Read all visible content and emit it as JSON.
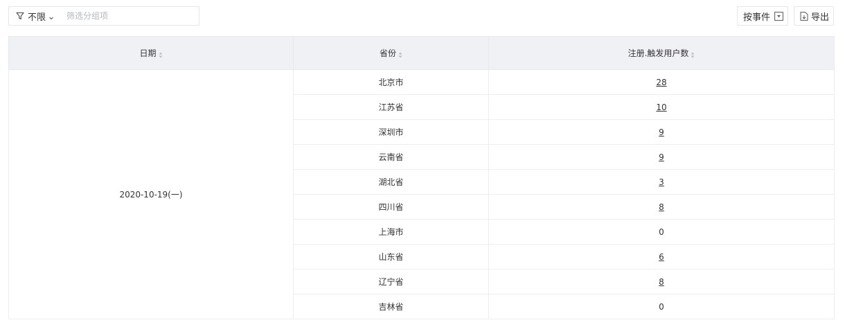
{
  "filter": {
    "label": "不限",
    "placeholder": "筛选分组项"
  },
  "toolbar": {
    "by_event_label": "按事件",
    "export_label": "导出"
  },
  "table": {
    "headers": [
      "日期",
      "省份",
      "注册.触发用户数"
    ],
    "date": "2020-10-19(一)",
    "rows": [
      {
        "province": "北京市",
        "count": "28",
        "link": true
      },
      {
        "province": "江苏省",
        "count": "10",
        "link": true
      },
      {
        "province": "深圳市",
        "count": "9",
        "link": true
      },
      {
        "province": "云南省",
        "count": "9",
        "link": true
      },
      {
        "province": "湖北省",
        "count": "3",
        "link": true
      },
      {
        "province": "四川省",
        "count": "8",
        "link": true
      },
      {
        "province": "上海市",
        "count": "0",
        "link": false
      },
      {
        "province": "山东省",
        "count": "6",
        "link": true
      },
      {
        "province": "辽宁省",
        "count": "8",
        "link": true
      },
      {
        "province": "吉林省",
        "count": "0",
        "link": false
      }
    ]
  }
}
